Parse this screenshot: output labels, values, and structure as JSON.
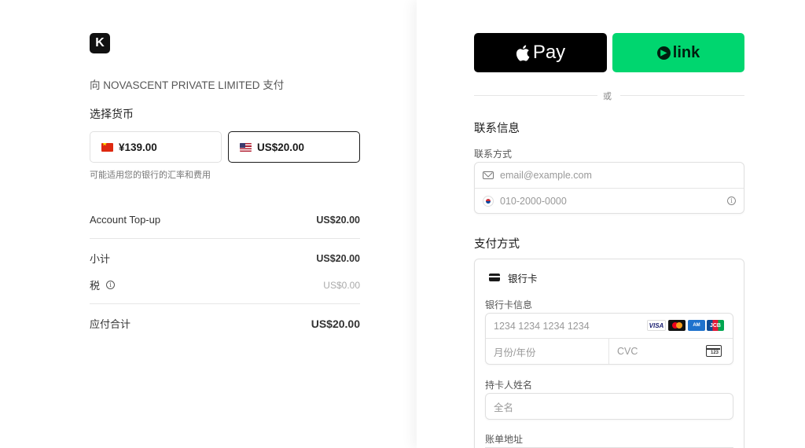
{
  "merchant": {
    "logo_letter": "K",
    "pay_to": "向 NOVASCENT PRIVATE LIMITED 支付"
  },
  "currency": {
    "heading": "选择货币",
    "options": [
      {
        "flag": "cn-flag-icon",
        "amount": "¥139.00",
        "selected": false
      },
      {
        "flag": "us-flag-icon",
        "amount": "US$20.00",
        "selected": true
      }
    ],
    "note": "可能适用您的银行的汇率和费用"
  },
  "summary": {
    "item_label": "Account Top-up",
    "item_value": "US$20.00",
    "subtotal_label": "小计",
    "subtotal_value": "US$20.00",
    "tax_label": "税",
    "tax_value": "US$0.00",
    "total_label": "应付合计",
    "total_value": "US$20.00"
  },
  "express": {
    "apple_pay_label": "Pay",
    "link_label": "link",
    "or_text": "或"
  },
  "contact": {
    "title": "联系信息",
    "method_label": "联系方式",
    "email_placeholder": "email@example.com",
    "phone_placeholder": "010-2000-0000"
  },
  "payment": {
    "title": "支付方式",
    "method_name": "银行卡",
    "card_info_label": "银行卡信息",
    "card_number_placeholder": "1234 1234 1234 1234",
    "expiry_placeholder": "月份/年份",
    "cvc_placeholder": "CVC",
    "cardholder_label": "持卡人姓名",
    "cardholder_placeholder": "全名",
    "billing_label": "账单地址",
    "brands": [
      "VISA",
      "mastercard",
      "amex",
      "JCB"
    ]
  },
  "colors": {
    "link_green": "#00d66f",
    "apple_black": "#000000",
    "border": "#e0e0e0"
  }
}
